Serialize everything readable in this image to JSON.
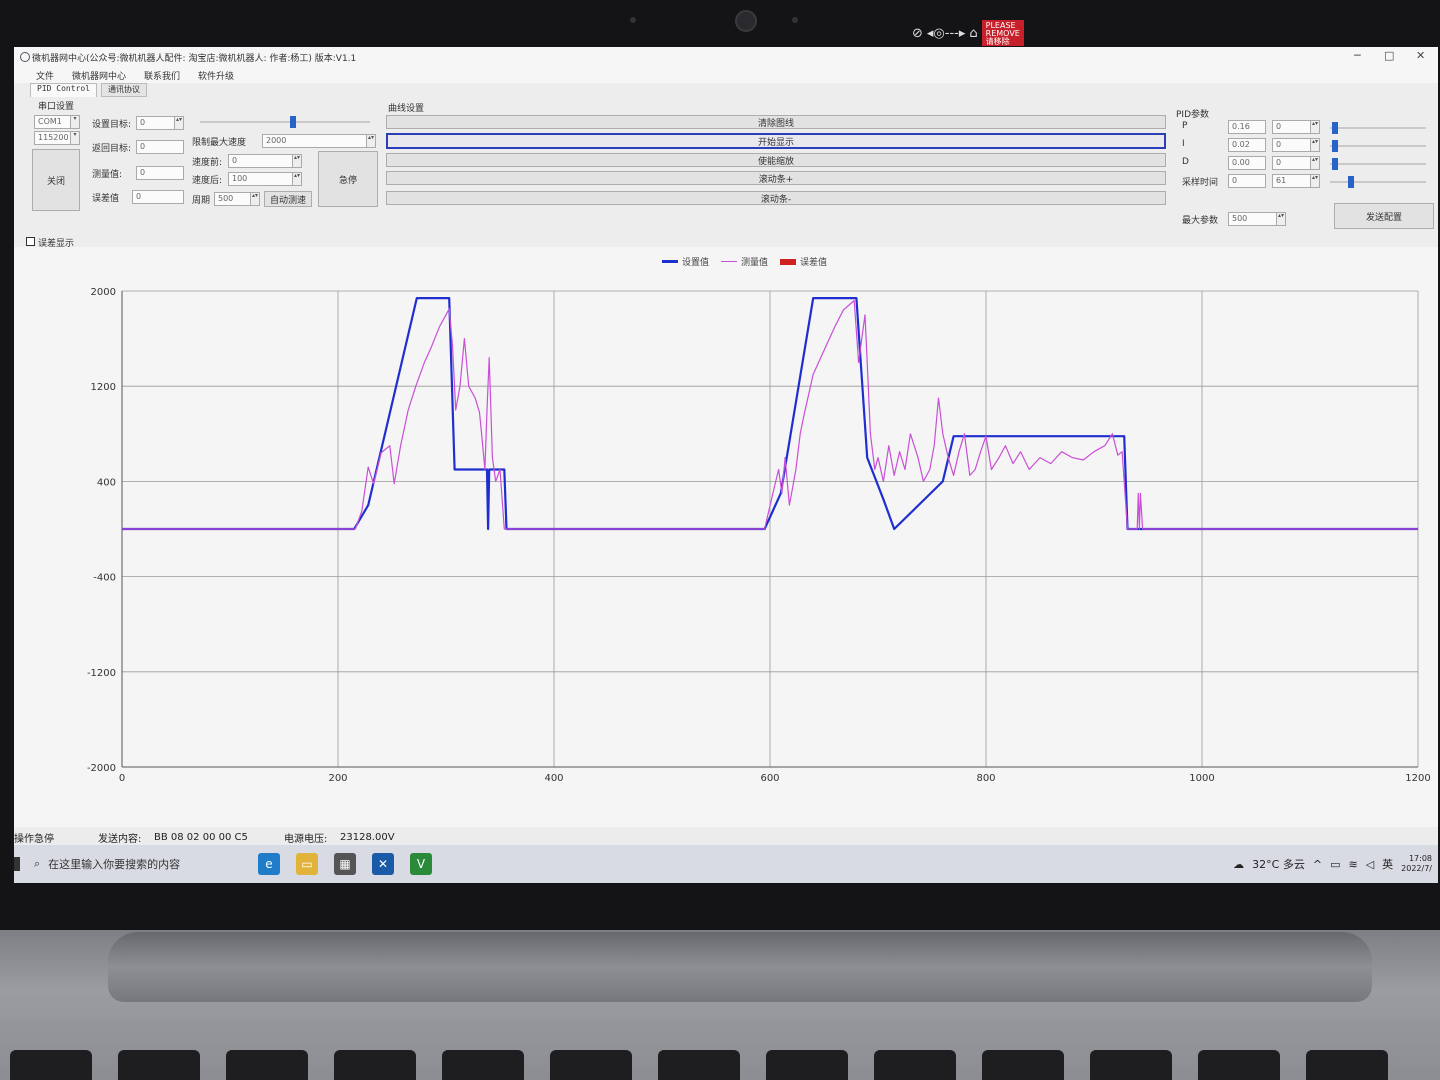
{
  "window": {
    "title": "微机器网中心(公众号:微机机器人配件: 淘宝店:微机机器人: 作者:杨工) 版本:V1.1",
    "minimize": "─",
    "maximize": "□",
    "close": "✕"
  },
  "privacy_sticker": {
    "remove_tag": "PLEASE REMOVE 请移除"
  },
  "menu": [
    "文件",
    "微机器网中心",
    "联系我们",
    "软件升级"
  ],
  "tabs": [
    "PID Control",
    "通讯协议"
  ],
  "serial": {
    "group_label": "串口设置",
    "port": "COM1",
    "baud": "115200",
    "toggle_button": "关闭"
  },
  "params": {
    "set_target_label": "设置目标:",
    "set_target_value": "0",
    "return_target_label": "返回目标:",
    "return_target_value": "0",
    "measured_label": "测量值:",
    "measured_value": "0",
    "error_label": "误差值",
    "error_value": "0",
    "max_speed_label": "限制最大速度",
    "max_speed_value": "2000",
    "speed_before_label": "速度前:",
    "speed_before_value": "0",
    "speed_after_label": "速度后:",
    "speed_after_value": "100",
    "period_label": "周期",
    "period_value": "500",
    "auto_tune_button": "自动测速",
    "estop_button": "急停",
    "target_slider_level": 0.55
  },
  "curve": {
    "group_label": "曲线设置",
    "buttons": [
      "清除图线",
      "开始显示",
      "使能缩放",
      "滚动条+",
      "滚动条-"
    ]
  },
  "pid": {
    "group_label": "PID参数",
    "rows": [
      {
        "label": "P",
        "value": "0.16",
        "extra": "0",
        "level": 0.02
      },
      {
        "label": "I",
        "value": "0.02",
        "extra": "0",
        "level": 0.02
      },
      {
        "label": "D",
        "value": "0.00",
        "extra": "0",
        "level": 0.02
      },
      {
        "label": "采样时间",
        "value": "0",
        "extra": "61",
        "level": 0.2
      }
    ],
    "max_param_label": "最大参数",
    "max_param_value": "500",
    "send_button": "发送配置"
  },
  "error_toggle": {
    "label": "误差显示",
    "checked": false
  },
  "colors": {
    "setpoint": "#1f2fcf",
    "measured": "#c94fd6",
    "error": "#d22020"
  },
  "chart_data": {
    "type": "line",
    "title": "",
    "xlabel": "",
    "ylabel": "",
    "xlim": [
      0,
      1200
    ],
    "ylim": [
      -2000,
      2000
    ],
    "x_ticks": [
      0,
      200,
      400,
      600,
      800,
      1000,
      1200
    ],
    "y_ticks": [
      2000,
      1200,
      400,
      -400,
      -1200,
      -2000
    ],
    "legend": {
      "placement": "top-center"
    },
    "grid": true,
    "series": [
      {
        "name": "设置值",
        "color": "#1f2fcf",
        "points": [
          [
            0,
            0
          ],
          [
            215,
            0
          ],
          [
            228,
            200
          ],
          [
            273,
            1940
          ],
          [
            303,
            1940
          ],
          [
            308,
            500
          ],
          [
            338,
            500
          ],
          [
            339,
            0
          ],
          [
            340,
            500
          ],
          [
            354,
            500
          ],
          [
            356,
            0
          ],
          [
            595,
            0
          ],
          [
            610,
            300
          ],
          [
            640,
            1940
          ],
          [
            680,
            1940
          ],
          [
            690,
            600
          ],
          [
            705,
            250
          ],
          [
            715,
            0
          ],
          [
            760,
            400
          ],
          [
            770,
            780
          ],
          [
            928,
            780
          ],
          [
            931,
            0
          ],
          [
            1200,
            0
          ]
        ]
      },
      {
        "name": "测量值",
        "color": "#c94fd6",
        "points": [
          [
            0,
            0
          ],
          [
            216,
            0
          ],
          [
            222,
            150
          ],
          [
            228,
            520
          ],
          [
            233,
            380
          ],
          [
            240,
            640
          ],
          [
            248,
            700
          ],
          [
            252,
            380
          ],
          [
            258,
            700
          ],
          [
            265,
            1000
          ],
          [
            272,
            1200
          ],
          [
            280,
            1400
          ],
          [
            286,
            1520
          ],
          [
            294,
            1700
          ],
          [
            300,
            1800
          ],
          [
            303,
            1850
          ],
          [
            306,
            1540
          ],
          [
            309,
            1000
          ],
          [
            313,
            1200
          ],
          [
            317,
            1600
          ],
          [
            321,
            1200
          ],
          [
            327,
            1100
          ],
          [
            331,
            980
          ],
          [
            333,
            800
          ],
          [
            336,
            500
          ],
          [
            338,
            1000
          ],
          [
            340,
            1440
          ],
          [
            343,
            600
          ],
          [
            346,
            400
          ],
          [
            350,
            500
          ],
          [
            354,
            0
          ],
          [
            595,
            0
          ],
          [
            604,
            350
          ],
          [
            608,
            500
          ],
          [
            611,
            300
          ],
          [
            614,
            600
          ],
          [
            618,
            200
          ],
          [
            624,
            500
          ],
          [
            628,
            800
          ],
          [
            632,
            980
          ],
          [
            640,
            1300
          ],
          [
            650,
            1500
          ],
          [
            660,
            1700
          ],
          [
            668,
            1840
          ],
          [
            678,
            1920
          ],
          [
            682,
            1400
          ],
          [
            685,
            1600
          ],
          [
            688,
            1800
          ],
          [
            690,
            1400
          ],
          [
            693,
            800
          ],
          [
            697,
            500
          ],
          [
            700,
            600
          ],
          [
            705,
            400
          ],
          [
            710,
            700
          ],
          [
            715,
            450
          ],
          [
            720,
            650
          ],
          [
            725,
            500
          ],
          [
            730,
            800
          ],
          [
            737,
            600
          ],
          [
            742,
            400
          ],
          [
            748,
            500
          ],
          [
            752,
            700
          ],
          [
            756,
            1100
          ],
          [
            760,
            800
          ],
          [
            765,
            600
          ],
          [
            770,
            450
          ],
          [
            775,
            650
          ],
          [
            780,
            800
          ],
          [
            785,
            450
          ],
          [
            790,
            500
          ],
          [
            795,
            650
          ],
          [
            800,
            780
          ],
          [
            805,
            500
          ],
          [
            812,
            600
          ],
          [
            818,
            700
          ],
          [
            825,
            550
          ],
          [
            832,
            650
          ],
          [
            840,
            500
          ],
          [
            850,
            600
          ],
          [
            860,
            550
          ],
          [
            870,
            650
          ],
          [
            880,
            600
          ],
          [
            890,
            580
          ],
          [
            900,
            650
          ],
          [
            910,
            700
          ],
          [
            917,
            800
          ],
          [
            922,
            620
          ],
          [
            926,
            650
          ],
          [
            931,
            0
          ],
          [
            940,
            0
          ],
          [
            941,
            300
          ],
          [
            942,
            0
          ],
          [
            943,
            300
          ],
          [
            945,
            0
          ],
          [
            1200,
            0
          ]
        ]
      },
      {
        "name": "误差值",
        "color": "#d22020",
        "points": []
      }
    ]
  },
  "status": {
    "state": "操作急停",
    "sent_label": "发送内容:",
    "sent_value": "BB 08 02 00 00 C5",
    "voltage_label": "电源电压:",
    "voltage_value": "23128.00V"
  },
  "taskbar": {
    "search_placeholder": "在这里输入你要搜索的内容",
    "weather": "32°C 多云",
    "ime": "英",
    "time": "17:08",
    "date": "2022/7/"
  }
}
